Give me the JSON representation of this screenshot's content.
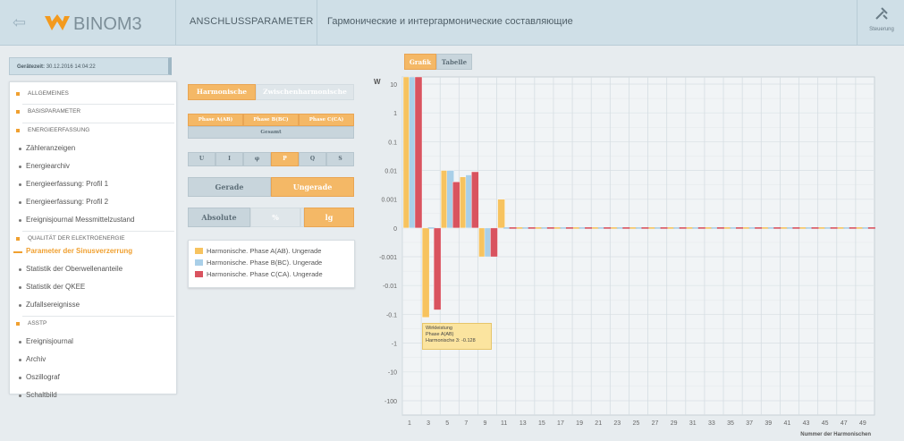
{
  "header": {
    "logo_text": "BINOM3",
    "breadcrumb_1": "ANSCHLUSSPARAMETER",
    "breadcrumb_2": "Гармонические и интергармонические составляющие",
    "control_label": "Steuerung"
  },
  "device_time": {
    "label": "Gerätezeit:",
    "value": "30.12.2016 14:04:22"
  },
  "sidebar": {
    "items": [
      {
        "type": "section",
        "label": "ALLGEMEINES"
      },
      {
        "type": "section",
        "label": "BASISPARAMETER"
      },
      {
        "type": "section",
        "label": "ENERGIEERFASSUNG"
      },
      {
        "type": "sub",
        "label": "Zähleranzeigen"
      },
      {
        "type": "sub",
        "label": "Energiearchiv"
      },
      {
        "type": "sub",
        "label": "Energieerfassung: Profil 1"
      },
      {
        "type": "sub",
        "label": "Energieerfassung: Profil 2"
      },
      {
        "type": "sub",
        "label": "Ereignisjournal Messmittelzustand"
      },
      {
        "type": "section",
        "label": "QUALITÄT DER ELEKTROENERGIE"
      },
      {
        "type": "sub",
        "label": "Parameter der Sinusverzerrung",
        "active": true
      },
      {
        "type": "sub",
        "label": "Statistik der Oberwellenanteile"
      },
      {
        "type": "sub",
        "label": "Statistik der QKEE"
      },
      {
        "type": "sub",
        "label": "Zufallsereignisse"
      },
      {
        "type": "section",
        "label": "ASSTP"
      },
      {
        "type": "sub",
        "label": "Ereignisjournal"
      },
      {
        "type": "sub",
        "label": "Archiv"
      },
      {
        "type": "sub",
        "label": "Oszillograf"
      },
      {
        "type": "sub",
        "label": "Schaltbild"
      }
    ]
  },
  "controls": {
    "harmonic_type": {
      "options": [
        "Harmonische",
        "Zwischenharmonische"
      ],
      "selected": "Harmonische"
    },
    "phases": {
      "options": [
        "Phase A(AB)",
        "Phase B(BC)",
        "Phase C(CA)"
      ],
      "total_label": "Gesamt"
    },
    "quantity": {
      "options": [
        "U",
        "I",
        "φ",
        "P",
        "Q",
        "S"
      ],
      "selected": "P"
    },
    "parity": {
      "options": [
        "Gerade",
        "Ungerade"
      ],
      "selected": "Ungerade"
    },
    "scale": {
      "options": [
        "Absolute",
        "%",
        "lg"
      ],
      "selected": "lg"
    }
  },
  "legend": {
    "entries": [
      {
        "label": "Harmonische. Phase A(AB). Ungerade",
        "color": "#f7c35f"
      },
      {
        "label": "Harmonische. Phase B(BC). Ungerade",
        "color": "#a9cfe8"
      },
      {
        "label": "Harmonische. Phase C(CA). Ungerade",
        "color": "#d9535f"
      }
    ]
  },
  "view_tabs": {
    "grafik": "Grafik",
    "tabelle": "Tabelle",
    "selected": "Grafik"
  },
  "tooltip": {
    "line1": "Wirkleistung",
    "line2": "Phase A(AB)",
    "line3": "Harmonische 3: -0.128"
  },
  "chart_data": {
    "type": "bar",
    "title": "",
    "ylabel": "W",
    "xlabel": "Nummer der Harmonischen",
    "y_scale": "symlog",
    "y_ticks": [
      "10",
      "1",
      "0.1",
      "0.01",
      "0.001",
      "0",
      "-0.001",
      "-0.01",
      "-0.1",
      "-1",
      "-10",
      "-100"
    ],
    "categories": [
      1,
      3,
      5,
      7,
      9,
      11,
      13,
      15,
      17,
      19,
      21,
      23,
      25,
      27,
      29,
      31,
      33,
      35,
      37,
      39,
      41,
      43,
      45,
      47,
      49
    ],
    "series": [
      {
        "name": "Harmonische. Phase A(AB). Ungerade",
        "color": "#f7c35f",
        "values": [
          30,
          -0.128,
          0.01,
          0.006,
          -0.001,
          0.001,
          0,
          0,
          0,
          0,
          0,
          0,
          0,
          0,
          0,
          0,
          0,
          0,
          0,
          0,
          0,
          0,
          0,
          0,
          0
        ]
      },
      {
        "name": "Harmonische. Phase B(BC). Ungerade",
        "color": "#a9cfe8",
        "values": [
          30,
          0,
          0.01,
          0.007,
          -0.001,
          0,
          0,
          0,
          0,
          0,
          0,
          0,
          0,
          0,
          0,
          0,
          0,
          0,
          0,
          0,
          0,
          0,
          0,
          0,
          0
        ]
      },
      {
        "name": "Harmonische. Phase C(CA). Ungerade",
        "color": "#d9535f",
        "values": [
          30,
          -0.07,
          0.004,
          0.009,
          -0.001,
          0,
          0,
          0,
          0,
          0,
          0,
          0,
          0,
          0,
          0,
          0,
          0,
          0,
          0,
          0,
          0,
          0,
          0,
          0,
          0
        ]
      }
    ],
    "grid": true
  }
}
